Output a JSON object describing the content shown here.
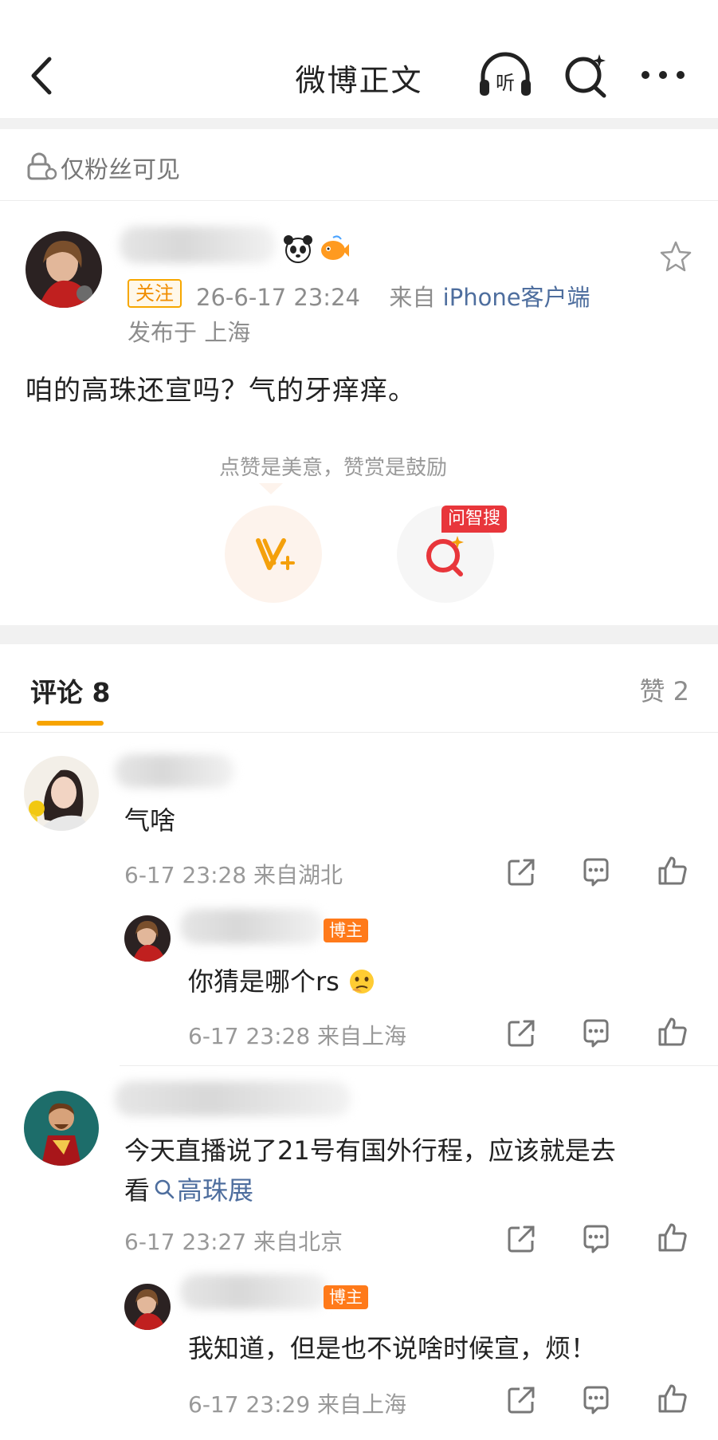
{
  "header": {
    "title": "微博正文"
  },
  "visibility": {
    "label": "仅粉丝可见"
  },
  "post": {
    "follow_label": "关注",
    "time": "26-6-17 23:24",
    "from_prefix": "来自",
    "source": "iPhone客户端",
    "location": "发布于 上海",
    "text": "咱的高珠还宣吗？气的牙痒痒。",
    "reward_tip": "点赞是美意，赞赏是鼓励",
    "wzs_badge": "问智搜"
  },
  "tabs": {
    "comments": "评论 8",
    "likes": "赞 2"
  },
  "comments": [
    {
      "text": "气啥",
      "meta": "6-17 23:28  来自湖北",
      "reply": {
        "badge": "博主",
        "text": "你猜是哪个rs",
        "meta": "6-17 23:28  来自上海"
      }
    },
    {
      "text_line1": "今天直播说了21号有国外行程，应该就是去",
      "text_line2_prefix": "看",
      "hashtag": "高珠展",
      "meta": "6-17 23:27  来自北京",
      "reply": {
        "badge": "博主",
        "text": "我知道，但是也不说啥时候宣，烦！",
        "meta": "6-17 23:29  来自上海"
      }
    }
  ],
  "colors": {
    "accent": "#f7a400",
    "link": "#4e6e9e",
    "badge": "#ff7a1a",
    "wzs": "#e8363b"
  }
}
